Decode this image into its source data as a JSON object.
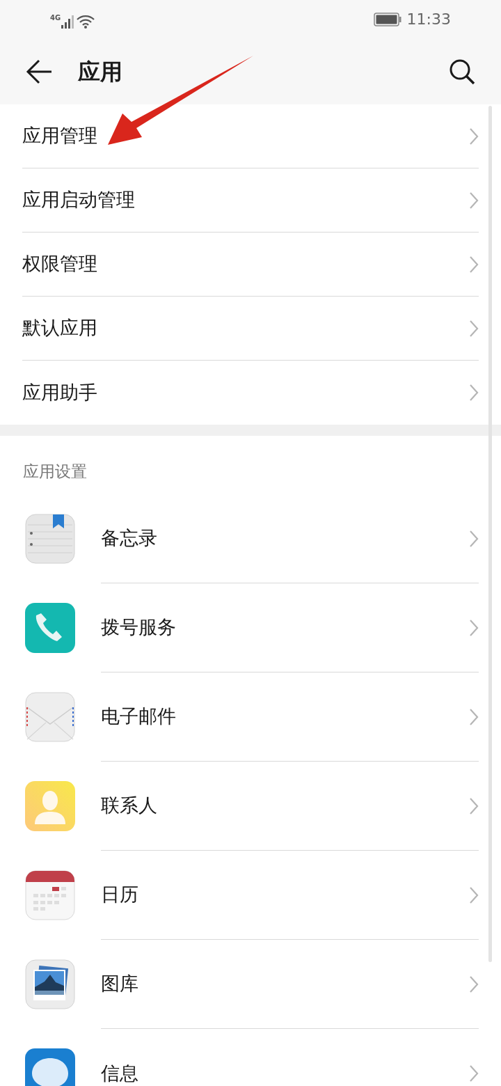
{
  "status_bar": {
    "network": "4G",
    "time": "11:33"
  },
  "header": {
    "title": "应用"
  },
  "menu": [
    {
      "label": "应用管理"
    },
    {
      "label": "应用启动管理"
    },
    {
      "label": "权限管理"
    },
    {
      "label": "默认应用"
    },
    {
      "label": "应用助手"
    }
  ],
  "app_settings": {
    "title": "应用设置",
    "apps": [
      {
        "kind": "notes",
        "label": "备忘录"
      },
      {
        "kind": "phone",
        "label": "拨号服务"
      },
      {
        "kind": "mail",
        "label": "电子邮件"
      },
      {
        "kind": "contacts",
        "label": "联系人"
      },
      {
        "kind": "calendar",
        "label": "日历"
      },
      {
        "kind": "gallery",
        "label": "图库"
      },
      {
        "kind": "messages",
        "label": "信息"
      }
    ]
  }
}
